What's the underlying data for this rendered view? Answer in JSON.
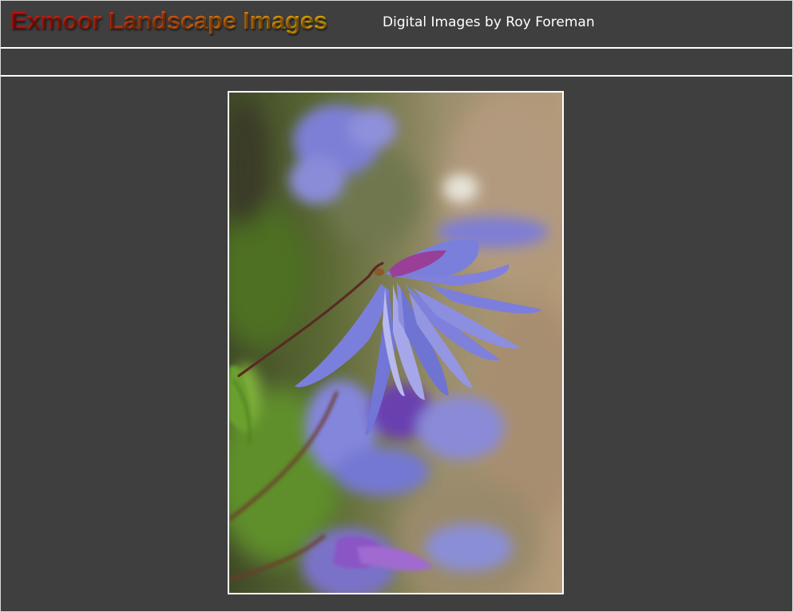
{
  "header": {
    "title": "Exmoor Landscape Images",
    "subtitle": "Digital Images by Roy Foreman"
  },
  "navbar": {
    "items": []
  },
  "photo": {
    "subject": "clematis-flower-photo",
    "colors": {
      "petal": "#7b7fd8",
      "petal_dark": "#6a3fb0",
      "stem": "#5a2a22",
      "leaf": "#6aa02e",
      "background": "#8c8a6a"
    }
  }
}
